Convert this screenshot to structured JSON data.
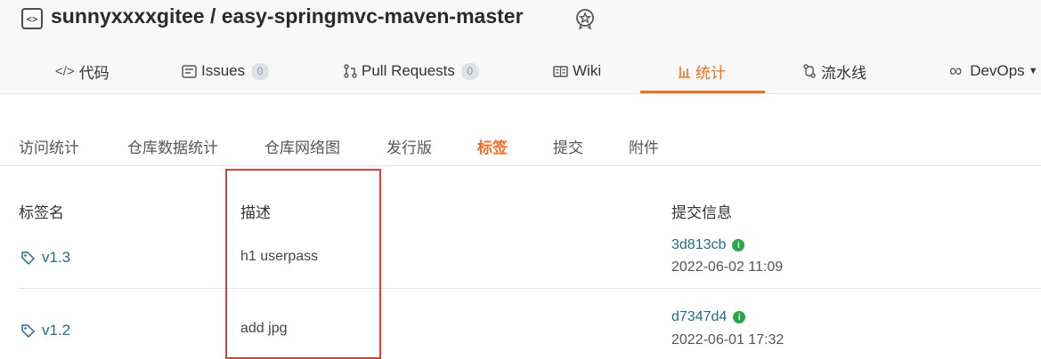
{
  "repo": {
    "title": "sunnyxxxxgitee / easy-springmvc-maven-master",
    "icon": "code-bracket-icon",
    "badge_icon": "award-badge-icon"
  },
  "nav": {
    "tabs": [
      {
        "label": "代码",
        "icon": "code-icon"
      },
      {
        "label": "Issues",
        "badge": "0",
        "icon": "issues-icon"
      },
      {
        "label": "Pull Requests",
        "badge": "0",
        "icon": "pull-request-icon"
      },
      {
        "label": "Wiki",
        "icon": "wiki-icon"
      },
      {
        "label": "统计",
        "icon": "chart-icon",
        "active": true
      },
      {
        "label": "流水线",
        "icon": "pipeline-icon"
      },
      {
        "label": "DevOps",
        "icon": "infinity-icon"
      }
    ],
    "accent_color": "#f56d1f"
  },
  "sub_tabs": [
    {
      "label": "访问统计"
    },
    {
      "label": "仓库数据统计"
    },
    {
      "label": "仓库网络图"
    },
    {
      "label": "发行版"
    },
    {
      "label": "标签",
      "active": true
    },
    {
      "label": "提交"
    },
    {
      "label": "附件"
    }
  ],
  "table": {
    "headers": [
      "标签名",
      "描述",
      "提交信息"
    ],
    "rows": [
      {
        "tag": "v1.3",
        "description": "h1 userpass",
        "commit": "3d813cb",
        "date": "2022-06-02 11:09"
      },
      {
        "tag": "v1.2",
        "description": "add jpg",
        "commit": "d7347d4",
        "date": "2022-06-01 17:32"
      }
    ]
  },
  "colors": {
    "link": "#1f6e8c",
    "status_ok": "#28a745",
    "highlight": "#e03a3a"
  }
}
